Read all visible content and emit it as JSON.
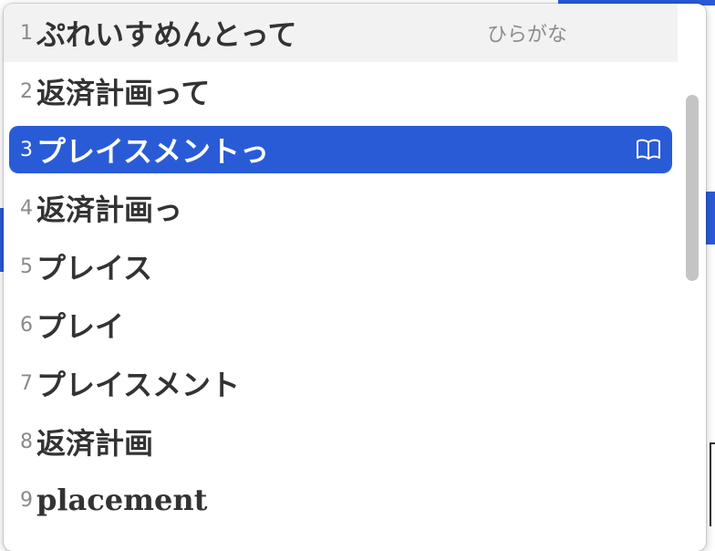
{
  "candidates": [
    {
      "number": "1",
      "text": "ぷれいすめんとって",
      "hint": "ひらがな"
    },
    {
      "number": "2",
      "text": "返済計画って"
    },
    {
      "number": "3",
      "text": "プレイスメントっ",
      "selected": true,
      "icon": "dictionary-book-icon"
    },
    {
      "number": "4",
      "text": "返済計画っ"
    },
    {
      "number": "5",
      "text": "プレイス"
    },
    {
      "number": "6",
      "text": "プレイ"
    },
    {
      "number": "7",
      "text": "プレイスメント"
    },
    {
      "number": "8",
      "text": "返済計画"
    },
    {
      "number": "9",
      "text": "placement"
    }
  ],
  "colors": {
    "selection": "#2a5bd7",
    "first_row_bg": "#f2f2f2",
    "candidate_text": "#333333",
    "number_text": "#8a8a8a"
  }
}
